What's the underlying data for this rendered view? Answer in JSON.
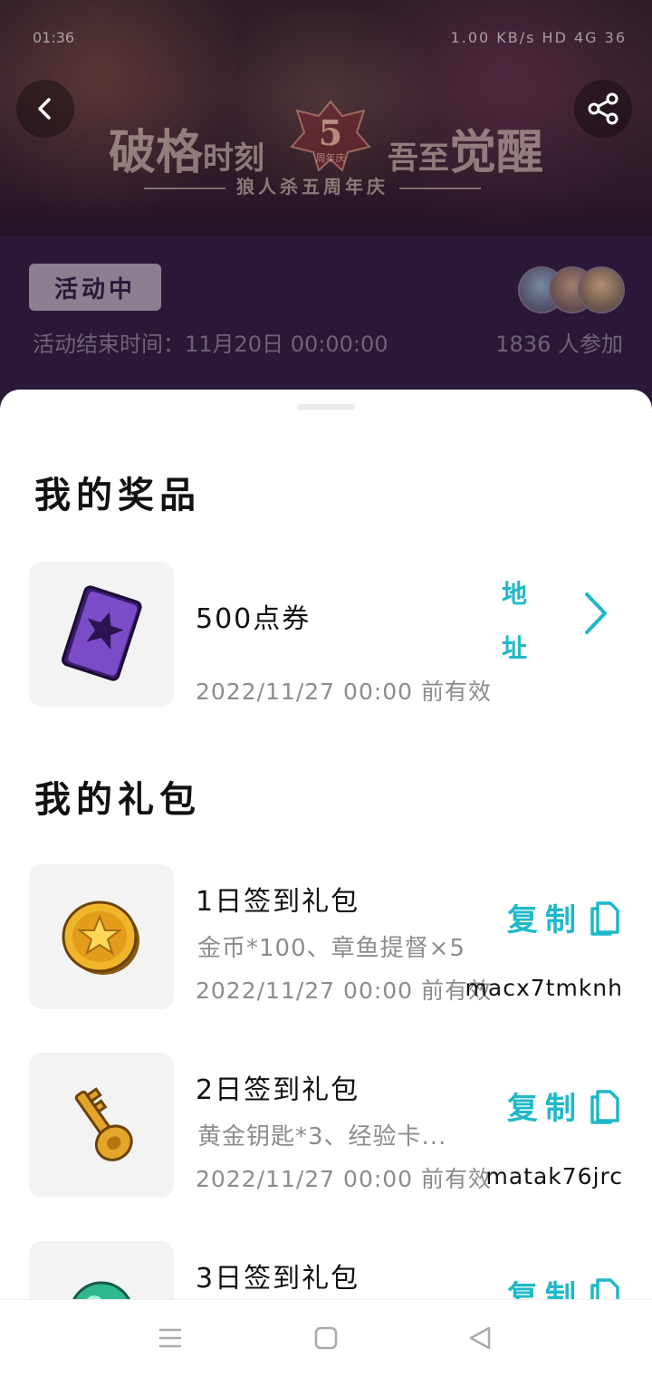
{
  "status_bar": {
    "time": "01:36",
    "right": "1.00 KB/s HD 4G 36"
  },
  "banner": {
    "title_left_big": "破格",
    "title_left_small": "时刻",
    "title_right_small": "吾至",
    "title_right_big": "觉醒",
    "badge_number": "5",
    "badge_text": "周年庆",
    "subtitle": "狼人杀五周年庆"
  },
  "activity": {
    "status": "活动中",
    "end_time": "活动结束时间：11月20日 00:00:00",
    "participants": "1836 人参加"
  },
  "prizes": {
    "section_title": "我的奖品",
    "items": [
      {
        "name": "500点券",
        "valid": "2022/11/27 00:00 前有效",
        "address_label": "地址",
        "icon": "purple-card-icon"
      }
    ]
  },
  "gifts": {
    "section_title": "我的礼包",
    "copy_label": "复制",
    "items": [
      {
        "name": "1日签到礼包",
        "desc": "金币*100、章鱼提督×5",
        "valid": "2022/11/27 00:00 前有效",
        "code": "macx7tmknh",
        "icon": "gold-coin-icon"
      },
      {
        "name": "2日签到礼包",
        "desc": "黄金钥匙*3、经验卡...",
        "valid": "2022/11/27 00:00 前有效",
        "code": "matak76jrc",
        "icon": "gold-key-icon"
      },
      {
        "name": "3日签到礼包",
        "desc": "",
        "valid": "",
        "code": "",
        "icon": "green-orb-icon"
      }
    ]
  },
  "colors": {
    "accent": "#1fb8c8",
    "header_bg": "#2a1838"
  }
}
